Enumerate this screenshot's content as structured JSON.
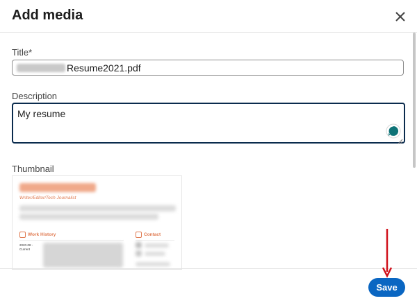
{
  "dialog": {
    "title": "Add media",
    "close_icon": "close-icon"
  },
  "form": {
    "title_label": "Title*",
    "title_value": "Resume2021.pdf",
    "description_label": "Description",
    "description_value": "My resume",
    "thumbnail_label": "Thumbnail"
  },
  "thumbnail": {
    "subtitle": "Writer/Editor/Tech Journalist",
    "section_work": "Work History",
    "section_contact": "Contact",
    "work_date_start": "2020-08 -",
    "work_date_current": "Current"
  },
  "footer": {
    "save_label": "Save"
  },
  "colors": {
    "primary": "#0a66c2",
    "focus_border": "#0a2b4d",
    "annotation_arrow": "#d0101b",
    "assistant_icon": "#0e7377",
    "resume_accent": "#e07a50"
  }
}
